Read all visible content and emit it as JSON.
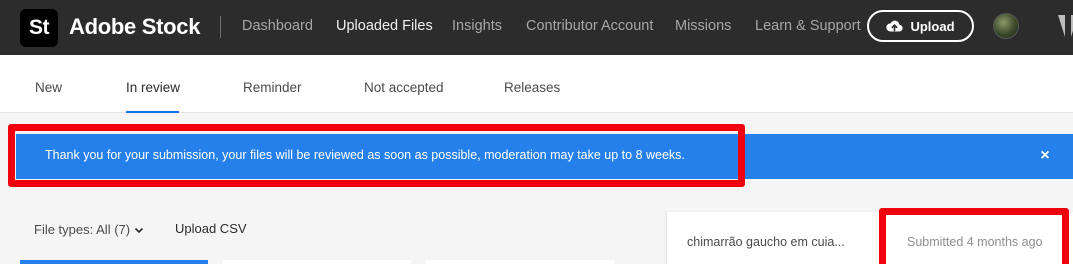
{
  "header": {
    "logo_text": "St",
    "brand": "Adobe Stock",
    "nav": [
      {
        "label": "Dashboard",
        "active": false
      },
      {
        "label": "Uploaded Files",
        "active": true
      },
      {
        "label": "Insights",
        "active": false
      },
      {
        "label": "Contributor Account",
        "active": false
      },
      {
        "label": "Missions",
        "active": false
      },
      {
        "label": "Learn & Support",
        "active": false
      }
    ],
    "upload_label": "Upload"
  },
  "tabs": [
    {
      "label": "New",
      "active": false
    },
    {
      "label": "In review",
      "active": true
    },
    {
      "label": "Reminder",
      "active": false
    },
    {
      "label": "Not accepted",
      "active": false
    },
    {
      "label": "Releases",
      "active": false
    }
  ],
  "banner": {
    "message": "Thank you for your submission, your files will be reviewed as soon as possible, moderation may take up to 8 weeks.",
    "close_glyph": "×"
  },
  "filters": {
    "file_types_label": "File types: All (7)",
    "upload_csv_label": "Upload CSV"
  },
  "submission": {
    "title": "chimarrão gaucho em cuia...",
    "status": "Submitted 4 months ago"
  },
  "colors": {
    "topbar": "#2c2c2c",
    "banner": "#2680eb",
    "annotation": "#f0000e",
    "accent": "#1473e6"
  }
}
